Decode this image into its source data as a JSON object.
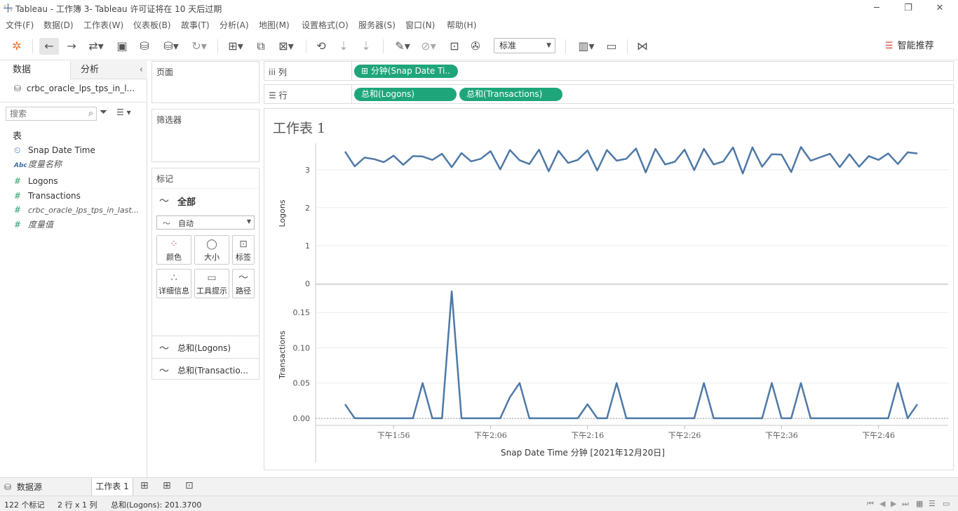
{
  "window": {
    "title": "Tableau - 工作簿 3- Tableau 许可证将在 10 天后过期"
  },
  "menu": [
    "文件(F)",
    "数据(D)",
    "工作表(W)",
    "仪表板(B)",
    "故事(T)",
    "分析(A)",
    "地图(M)",
    "设置格式(O)",
    "服务器(S)",
    "窗口(N)",
    "帮助(H)"
  ],
  "toolbar": {
    "fit_select": "标准",
    "show_me": "智能推荐"
  },
  "data_pane": {
    "tab_data": "数据",
    "tab_analysis": "分析",
    "datasource": "crbc_oracle_lps_tps_in_l...",
    "search_placeholder": "搜索",
    "section_tables": "表",
    "fields": [
      {
        "name": "Snap Date Time",
        "type": "date"
      },
      {
        "name": "度量名称",
        "type": "abc"
      },
      {
        "name": "Logons",
        "type": "num"
      },
      {
        "name": "Transactions",
        "type": "num"
      },
      {
        "name": "crbc_oracle_lps_tps_in_last...",
        "type": "num"
      },
      {
        "name": "度量值",
        "type": "num"
      }
    ]
  },
  "pages_card": {
    "label": "页面"
  },
  "filters_card": {
    "label": "筛选器"
  },
  "marks_card": {
    "label": "标记",
    "all": "全部",
    "mark_type": "自动",
    "buttons": [
      "颜色",
      "大小",
      "标签",
      "详细信息",
      "工具提示",
      "路径"
    ],
    "measures": [
      "总和(Logons)",
      "总和(Transactio..."
    ]
  },
  "shelves": {
    "columns_label": "列",
    "rows_label": "行",
    "column_pill": "分钟(Snap Date Ti..",
    "row_pills": [
      "总和(Logons)",
      "总和(Transactions)"
    ]
  },
  "sheet": {
    "title": "工作表 1",
    "x_title": "Snap Date Time 分钟 [2021年12月20日]"
  },
  "chart_data": [
    {
      "type": "line",
      "ylabel": "Logons",
      "ylim": [
        0,
        3.7
      ],
      "yticks": [
        0,
        1,
        2,
        3
      ],
      "x_ticks": [
        "下午1:56",
        "下午2:06",
        "下午2:16",
        "下午2:26",
        "下午2:36",
        "下午2:46"
      ],
      "x_start": "下午1:51",
      "values": [
        3.48,
        3.09,
        3.32,
        3.28,
        3.2,
        3.37,
        3.13,
        3.36,
        3.35,
        3.26,
        3.42,
        3.07,
        3.44,
        3.22,
        3.29,
        3.49,
        3.01,
        3.52,
        3.25,
        3.15,
        3.53,
        2.96,
        3.5,
        3.18,
        3.26,
        3.51,
        2.98,
        3.52,
        3.24,
        3.29,
        3.56,
        2.93,
        3.55,
        3.14,
        3.21,
        3.53,
        2.99,
        3.55,
        3.14,
        3.22,
        3.59,
        2.9,
        3.59,
        3.08,
        3.41,
        3.4,
        2.94,
        3.6,
        3.24,
        3.33,
        3.42,
        3.07,
        3.41,
        3.08,
        3.36,
        3.26,
        3.43,
        3.15,
        3.46,
        3.43
      ],
      "color": "#4e79a7"
    },
    {
      "type": "line",
      "ylabel": "Transactions",
      "ylim": [
        -0.01,
        0.19
      ],
      "yticks": [
        0.0,
        0.05,
        0.1,
        0.15
      ],
      "ytick_labels": [
        "0.00",
        "0.05",
        "0.10",
        "0.15"
      ],
      "values": [
        0.02,
        0,
        0,
        0,
        0,
        0,
        0,
        0,
        0.05,
        0,
        0,
        0.18,
        0,
        0,
        0,
        0,
        0,
        0.03,
        0.05,
        0,
        0,
        0,
        0,
        0,
        0,
        0.02,
        0,
        0,
        0.05,
        0,
        0,
        0,
        0,
        0,
        0,
        0,
        0,
        0.05,
        0,
        0,
        0,
        0,
        0,
        0,
        0.05,
        0,
        0,
        0.05,
        0,
        0,
        0,
        0,
        0,
        0,
        0,
        0,
        0,
        0.05,
        0,
        0.02
      ],
      "color": "#4e79a7"
    }
  ],
  "tabs": {
    "datasource": "数据源",
    "sheet1": "工作表 1"
  },
  "status": {
    "marks": "122 个标记",
    "dims": "2 行 x 1 列",
    "sum": "总和(Logons): 201.3700"
  }
}
